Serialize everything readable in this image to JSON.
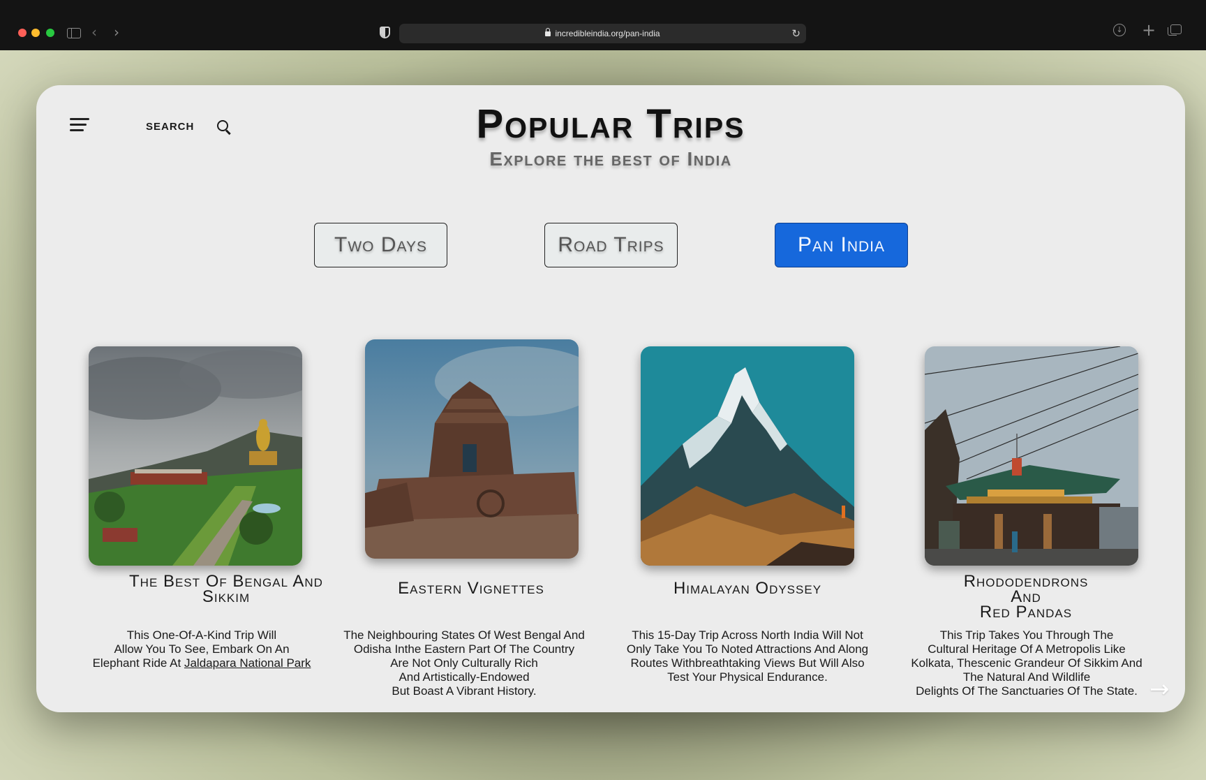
{
  "browser": {
    "url": "incredibleindia.org/pan-india"
  },
  "header": {
    "search_label": "SEARCH",
    "title": "Popular Trips",
    "subtitle": "Explore the best of India"
  },
  "tabs": [
    {
      "label": "Two Days",
      "active": false
    },
    {
      "label": "Road Trips",
      "active": false
    },
    {
      "label": "Pan India",
      "active": true
    }
  ],
  "colors": {
    "accent": "#1668dc",
    "card_background": "#ececec"
  },
  "trips": [
    {
      "title": "The Best Of Bengal And Sikkim",
      "desc_lines": [
        "This One-Of-A-Kind Trip Will",
        "Allow You To See, Embark On An",
        "Elephant Ride At"
      ],
      "link": "Jaldapara National Park"
    },
    {
      "title": "Eastern Vignettes",
      "desc_lines": [
        "The Neighbouring States Of West Bengal And",
        "Odisha Inthe Eastern Part Of The Country",
        "Are Not Only Culturally Rich",
        "And Artistically-Endowed",
        "But Boast A Vibrant History."
      ]
    },
    {
      "title": "Himalayan Odyssey",
      "desc_lines": [
        "This 15-Day Trip Across North India Will Not",
        "Only Take You To Noted Attractions And Along",
        "Routes Withbreathtaking Views But Will Also",
        "Test Your Physical Endurance."
      ]
    },
    {
      "title_lines": [
        "Rhododendrons",
        "And",
        "Red Pandas"
      ],
      "desc_lines": [
        "This Trip Takes You Through The",
        "Cultural Heritage Of A Metropolis Like",
        "Kolkata, Thescenic Grandeur Of Sikkim And",
        "The Natural And Wildlife",
        "Delights Of The Sanctuaries Of The State."
      ]
    }
  ]
}
